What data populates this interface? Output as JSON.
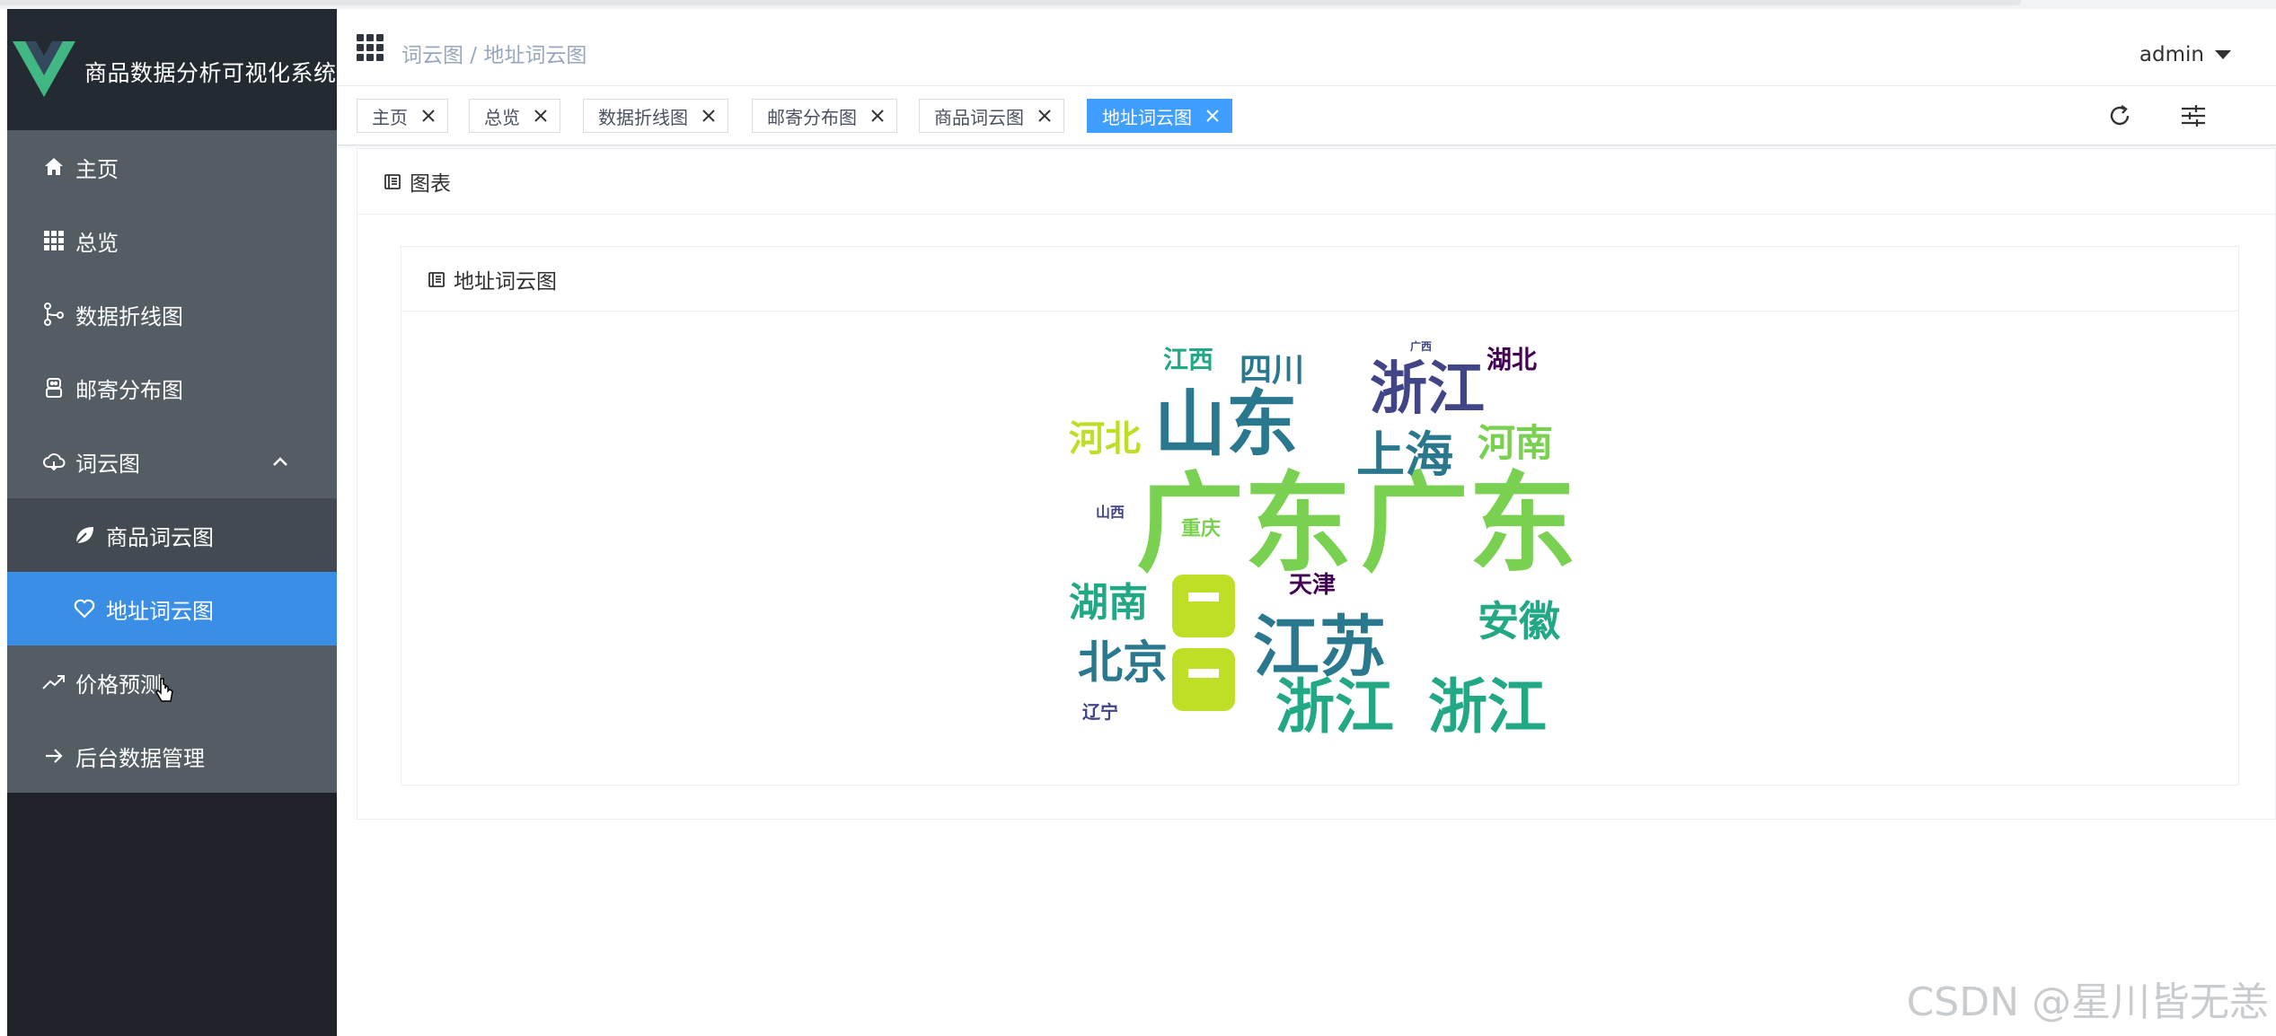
{
  "app": {
    "title": "商品数据分析可视化系统"
  },
  "header": {
    "breadcrumb": "词云图 / 地址词云图",
    "user": "admin"
  },
  "sidebar": {
    "items": [
      {
        "label": "主页",
        "icon": "home-icon"
      },
      {
        "label": "总览",
        "icon": "grid-icon"
      },
      {
        "label": "数据折线图",
        "icon": "branch-icon"
      },
      {
        "label": "邮寄分布图",
        "icon": "robot-icon"
      },
      {
        "label": "词云图",
        "icon": "cloud-icon",
        "expanded": true,
        "children": [
          {
            "label": "商品词云图",
            "icon": "leaf-icon"
          },
          {
            "label": "地址词云图",
            "icon": "heart-icon",
            "active": true
          }
        ]
      },
      {
        "label": "价格预测",
        "icon": "trend-icon"
      },
      {
        "label": "后台数据管理",
        "icon": "arrow-right-icon"
      }
    ]
  },
  "tags": [
    {
      "label": "主页"
    },
    {
      "label": "总览"
    },
    {
      "label": "数据折线图"
    },
    {
      "label": "邮寄分布图"
    },
    {
      "label": "商品词云图"
    },
    {
      "label": "地址词云图",
      "active": true
    }
  ],
  "main": {
    "card_title": "图表",
    "inner_title": "地址词云图"
  },
  "wordcloud": {
    "words": [
      {
        "text": "广东",
        "color": "#7ad151"
      },
      {
        "text": "广东",
        "color": "#7ad151"
      },
      {
        "text": "山东",
        "color": "#2a788e"
      },
      {
        "text": "浙江",
        "color": "#22a884"
      },
      {
        "text": "浙江",
        "color": "#22a884"
      },
      {
        "text": "浙江",
        "color": "#414487"
      },
      {
        "text": "江苏",
        "color": "#2a788e"
      },
      {
        "text": "上海",
        "color": "#2a788e"
      },
      {
        "text": "河南",
        "color": "#7ad151"
      },
      {
        "text": "河北",
        "color": "#bddf26"
      },
      {
        "text": "湖南",
        "color": "#22a884"
      },
      {
        "text": "北京",
        "color": "#2a788e"
      },
      {
        "text": "安徽",
        "color": "#22a884"
      },
      {
        "text": "四川",
        "color": "#2a788e"
      },
      {
        "text": "湖北",
        "color": "#440154"
      },
      {
        "text": "江西",
        "color": "#22a884"
      },
      {
        "text": "天津",
        "color": "#440154"
      },
      {
        "text": "重庆",
        "color": "#7ad151"
      },
      {
        "text": "辽宁",
        "color": "#414487"
      },
      {
        "text": "山西",
        "color": "#414487"
      },
      {
        "text": "广西",
        "color": "#414487"
      }
    ]
  },
  "colors": {
    "sidebar_bg": "#1f2329",
    "menu_bg": "#545c64",
    "submenu_bg": "#434a52",
    "active": "#409eff"
  },
  "watermark": "CSDN @星川皆无恙"
}
